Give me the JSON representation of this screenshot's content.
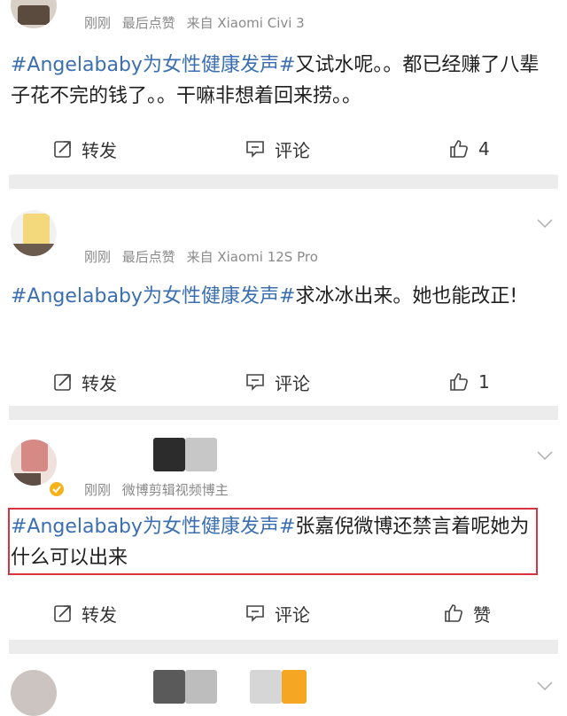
{
  "posts": [
    {
      "time": "刚刚",
      "last_like": "最后点赞",
      "source": "来自 Xiaomi Civi 3",
      "hashtag": "#Angelababy为女性健康发声#",
      "text": "又试水呢。。都已经赚了八辈子花不完的钱了。。干嘛非想着回来捞。。",
      "repost_label": "转发",
      "comment_label": "评论",
      "like_label": "4"
    },
    {
      "time": "刚刚",
      "last_like": "最后点赞",
      "source": "来自 Xiaomi 12S Pro",
      "hashtag": "#Angelababy为女性健康发声#",
      "text": "求冰冰出来。她也能改正!",
      "repost_label": "转发",
      "comment_label": "评论",
      "like_label": "1"
    },
    {
      "time": "刚刚",
      "user_desc": "微博剪辑视频博主",
      "hashtag": "#Angelababy为女性健康发声#",
      "text": "张嘉倪微博还禁言着呢她为什么可以出来",
      "repost_label": "转发",
      "comment_label": "评论",
      "like_label": "赞"
    }
  ],
  "icons": {
    "repost": "repost-icon",
    "comment": "comment-icon",
    "like": "thumbs-up-icon",
    "more": "chevron-down-icon",
    "verified": "verified-badge-icon"
  },
  "colors": {
    "hashtag": "#3b6fb2",
    "highlight_box": "#d9333f",
    "verified_badge": "#f5b21b",
    "separator": "#ececec"
  }
}
